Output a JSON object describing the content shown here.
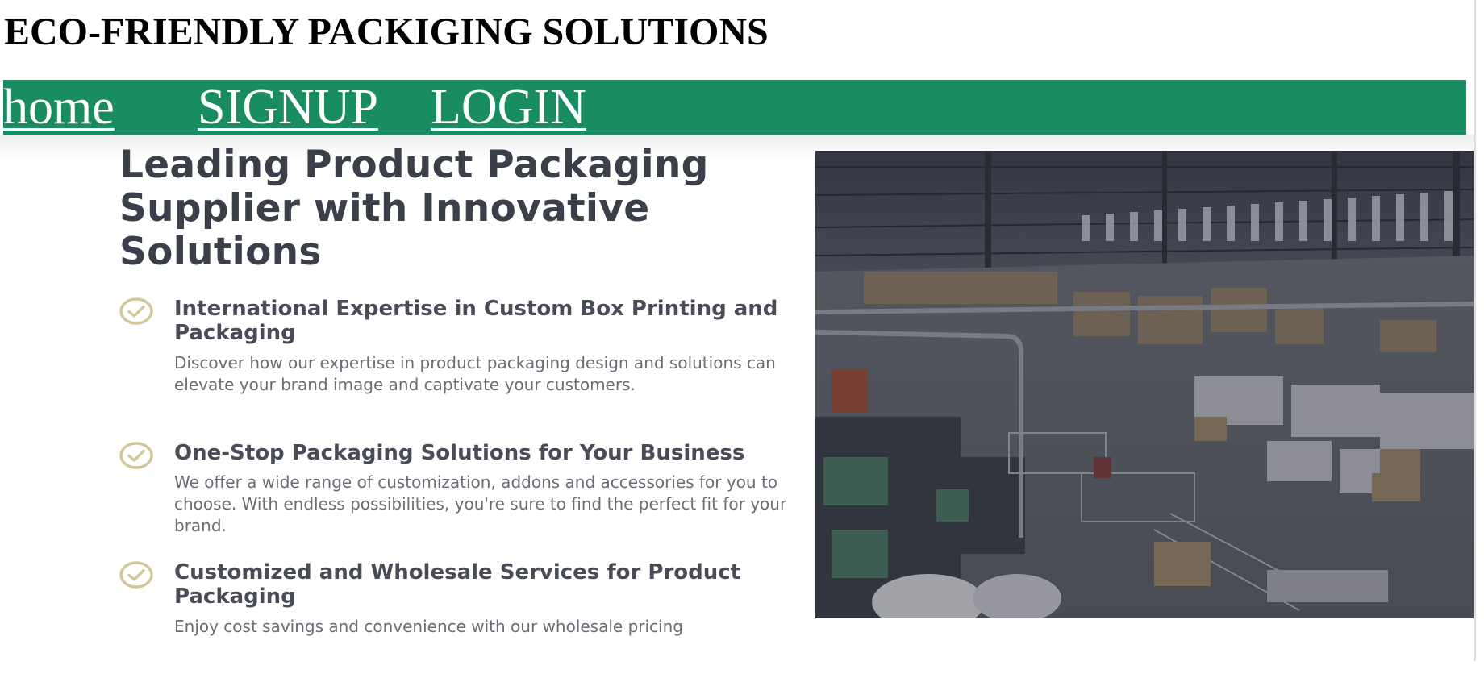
{
  "site": {
    "title": "ECO-FRIENDLY PACKIGING SOLUTIONS"
  },
  "nav": {
    "items": [
      {
        "label": "home"
      },
      {
        "label": "SIGNUP"
      },
      {
        "label": "LOGIN"
      }
    ]
  },
  "hero": {
    "heading": "Leading Product Packaging Supplier with Innovative Solutions",
    "features": [
      {
        "icon": "check-circle-icon",
        "title": "International Expertise in Custom Box Printing and Packaging",
        "description": "Discover how our expertise in product packaging design and solutions can elevate your brand image and captivate your customers."
      },
      {
        "icon": "check-circle-icon",
        "title": "One-Stop Packaging Solutions for Your Business",
        "description": "We offer a wide range of customization, addons and accessories for you to choose. With endless possibilities, you're sure to find the perfect fit for your brand."
      },
      {
        "icon": "check-circle-icon",
        "title": "Customized and Wholesale Services for Product Packaging",
        "description": "Enjoy cost savings and convenience with our wholesale pricing"
      }
    ]
  },
  "colors": {
    "nav_background": "#1a8c62",
    "heading_text": "#3b3f4a",
    "check_icon": "#d3c79a",
    "body_text": "#6b6d75"
  }
}
